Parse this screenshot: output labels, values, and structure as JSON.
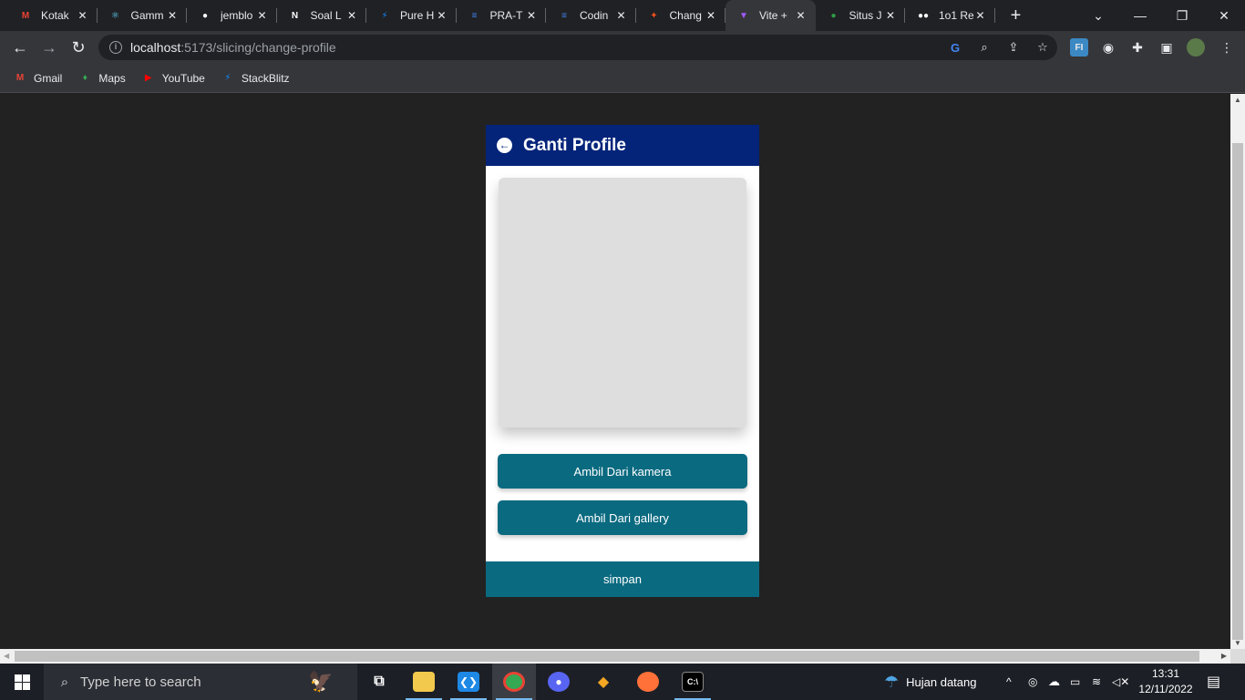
{
  "browser": {
    "tabs": [
      {
        "title": "Kotak",
        "favicon": "gmail-icon",
        "color": "#ea4335",
        "glyph": "M",
        "active": false
      },
      {
        "title": "Gamm",
        "favicon": "react-icon",
        "color": "#61dafb",
        "glyph": "⚛",
        "active": false
      },
      {
        "title": "jemblo",
        "favicon": "github-icon",
        "color": "#ffffff",
        "glyph": "●",
        "active": false
      },
      {
        "title": "Soal L",
        "favicon": "notion-icon",
        "color": "#ffffff",
        "glyph": "N",
        "active": false
      },
      {
        "title": "Pure H",
        "favicon": "stackblitz-icon",
        "color": "#1389fd",
        "glyph": "⚡",
        "active": false
      },
      {
        "title": "PRA-T",
        "favicon": "docs-icon",
        "color": "#4285f4",
        "glyph": "≡",
        "active": false
      },
      {
        "title": "Codin",
        "favicon": "docs-icon",
        "color": "#4285f4",
        "glyph": "≡",
        "active": false
      },
      {
        "title": "Chang",
        "favicon": "figma-icon",
        "color": "#f24e1e",
        "glyph": "✦",
        "active": false
      },
      {
        "title": "Vite +",
        "favicon": "vite-icon",
        "color": "#a259ff",
        "glyph": "▼",
        "active": true
      },
      {
        "title": "Situs J",
        "favicon": "situs-icon",
        "color": "#2e9e48",
        "glyph": "●",
        "active": false
      },
      {
        "title": "1o1 Re",
        "favicon": "medium-icon",
        "color": "#ffffff",
        "glyph": "●●",
        "active": false
      }
    ],
    "url_host": "localhost",
    "url_path": ":5173/slicing/change-profile",
    "bookmarks": [
      {
        "label": "Gmail",
        "icon": "gmail-icon",
        "color": "#ea4335",
        "glyph": "M"
      },
      {
        "label": "Maps",
        "icon": "maps-icon",
        "color": "#34a853",
        "glyph": "♦"
      },
      {
        "label": "YouTube",
        "icon": "youtube-icon",
        "color": "#ff0000",
        "glyph": "▶"
      },
      {
        "label": "StackBlitz",
        "icon": "stackblitz-icon",
        "color": "#1389fd",
        "glyph": "⚡"
      }
    ]
  },
  "app": {
    "title": "Ganti Profile",
    "camera_button": "Ambil Dari kamera",
    "gallery_button": "Ambil Dari gallery",
    "save_button": "simpan",
    "colors": {
      "header": "#04247a",
      "button": "#0a6a80",
      "placeholder": "#dedede"
    }
  },
  "taskbar": {
    "search_placeholder": "Type here to search",
    "weather": "Hujan datang",
    "time": "13:31",
    "date": "12/11/2022"
  }
}
